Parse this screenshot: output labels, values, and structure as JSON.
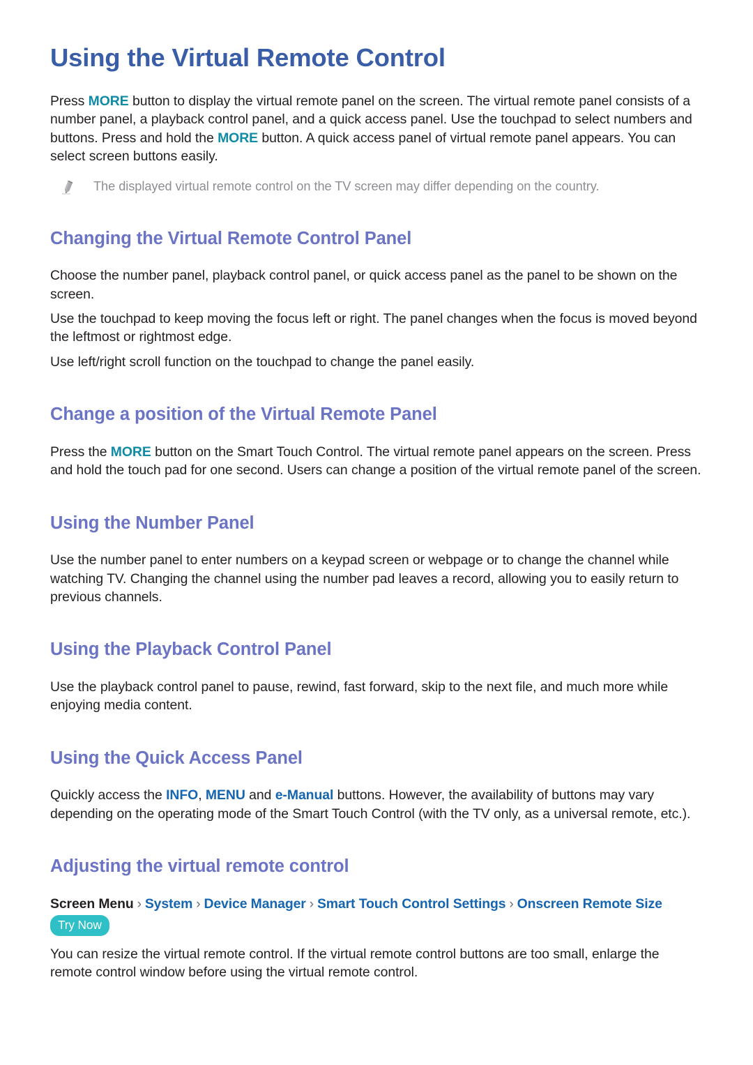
{
  "document": {
    "title": "Using the Virtual Remote Control"
  },
  "intro": {
    "paragraph_parts": [
      {
        "text": "Press ",
        "style": "plain"
      },
      {
        "text": "MORE",
        "style": "teal"
      },
      {
        "text": " button to display the virtual remote panel on the screen. The virtual remote panel consists of a number panel, a playback control panel, and a quick access panel. Use the touchpad to select numbers and buttons. Press and hold the ",
        "style": "plain"
      },
      {
        "text": "MORE",
        "style": "teal"
      },
      {
        "text": " button. A quick access panel of virtual remote panel appears. You can select screen buttons easily.",
        "style": "plain"
      }
    ],
    "note": {
      "icon": "pencil-icon",
      "text": "The displayed virtual remote control on the TV screen may differ depending on the country."
    }
  },
  "sections": [
    {
      "id": "changing-panel",
      "heading": "Changing the Virtual Remote Control Panel",
      "paragraphs": [
        "Choose the number panel, playback control panel, or quick access panel as the panel to be shown on the screen.",
        "Use the touchpad to keep moving the focus left or right. The panel changes when the focus is moved beyond the leftmost or rightmost edge.",
        "Use left/right scroll function on the touchpad to change the panel easily."
      ]
    },
    {
      "id": "change-position",
      "heading": "Change a position of the Virtual Remote Panel",
      "paragraph_parts": [
        {
          "text": "Press the ",
          "style": "plain"
        },
        {
          "text": "MORE",
          "style": "teal"
        },
        {
          "text": " button on the Smart Touch Control. The virtual remote panel appears on the screen. Press and hold the touch pad for one second. Users can change a position of the virtual remote panel of the screen.",
          "style": "plain"
        }
      ]
    },
    {
      "id": "number-panel",
      "heading": "Using the Number Panel",
      "paragraphs": [
        "Use the number panel to enter numbers on a keypad screen or webpage or to change the channel while watching TV. Changing the channel using the number pad leaves a record, allowing you to easily return to previous channels."
      ]
    },
    {
      "id": "playback-panel",
      "heading": "Using the Playback Control Panel",
      "paragraphs": [
        "Use the playback control panel to pause, rewind, fast forward, skip to the next file, and much more while enjoying media content."
      ]
    },
    {
      "id": "quick-access-panel",
      "heading": "Using the Quick Access Panel",
      "paragraph_parts": [
        {
          "text": "Quickly access the ",
          "style": "plain"
        },
        {
          "text": "INFO",
          "style": "blue"
        },
        {
          "text": ", ",
          "style": "plain"
        },
        {
          "text": "MENU",
          "style": "blue"
        },
        {
          "text": " and ",
          "style": "plain"
        },
        {
          "text": "e-Manual",
          "style": "blue"
        },
        {
          "text": " buttons. However, the availability of buttons may vary depending on the operating mode of the Smart Touch Control (with the TV only, as a universal remote, etc.).",
          "style": "plain"
        }
      ]
    },
    {
      "id": "adjusting-remote",
      "heading": "Adjusting the virtual remote control",
      "breadcrumb": {
        "root": "Screen Menu",
        "separator": "›",
        "links": [
          "System",
          "Device Manager",
          "Smart Touch Control Settings",
          "Onscreen Remote Size"
        ],
        "badge": "Try Now"
      },
      "paragraphs": [
        "You can resize the virtual remote control. If the virtual remote control buttons are too small, enlarge the remote control window before using the virtual remote control."
      ]
    }
  ],
  "colors": {
    "title": "#3a5da8",
    "heading": "#6b74c4",
    "body": "#231f20",
    "keyword_teal": "#0f8ba6",
    "keyword_blue": "#1565b0",
    "note_text": "#8d8d93",
    "badge_background": "#2ec0c6",
    "badge_text": "#ffffff",
    "page_background": "#ffffff"
  }
}
